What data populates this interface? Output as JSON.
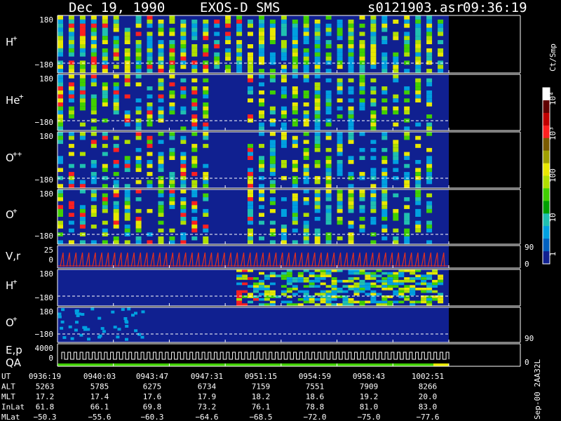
{
  "header": {
    "title": "Dec 19, 1990",
    "instrument": "EXOS-D SMS",
    "file": "s0121903.asr",
    "time": "09:36:19"
  },
  "colorbar": {
    "unit": "Ct/Smp",
    "ticks": [
      "10⁴",
      "10³",
      "100",
      "10",
      "1"
    ],
    "colors": [
      "#ffffff",
      "#600000",
      "#c00000",
      "#ff2020",
      "#7a5a00",
      "#a0a000",
      "#e8e800",
      "#b0e000",
      "#40d000",
      "#00a000",
      "#20c0b0",
      "#00a0e0",
      "#0060c0",
      "#102090"
    ]
  },
  "panels": [
    {
      "id": "h-plus",
      "species": "H",
      "charge": "+",
      "ytop": "180",
      "ybot": "−180"
    },
    {
      "id": "he-plus",
      "species": "He",
      "charge": "+",
      "ytop": "180",
      "ybot": "−180"
    },
    {
      "id": "o-plusplus",
      "species": "O",
      "charge": "++",
      "ytop": "180",
      "ybot": "−180"
    },
    {
      "id": "o-plus",
      "species": "O",
      "charge": "+",
      "ytop": "180",
      "ybot": "−180"
    },
    {
      "id": "vr",
      "label": "V,r",
      "ytop": "25",
      "ybot": "0",
      "right_top": "90",
      "right_bot": "0"
    },
    {
      "id": "h-plus-2",
      "species": "H",
      "charge": "+",
      "ytop": "180",
      "ybot": "−180"
    },
    {
      "id": "o-plus-2",
      "species": "O",
      "charge": "+",
      "ytop": "180",
      "ybot": "−180",
      "right_bot": "90"
    },
    {
      "id": "ep-qa",
      "label1": "E,p",
      "label2": "QA",
      "ytop": "4000",
      "ybot": "0",
      "right_bot": "0"
    }
  ],
  "footer": {
    "rows": [
      {
        "label": "UT",
        "values": [
          "0936:19",
          "0940:03",
          "0943:47",
          "0947:31",
          "0951:15",
          "0954:59",
          "0958:43",
          "1002:51"
        ]
      },
      {
        "label": "ALT",
        "values": [
          "5263",
          "5785",
          "6275",
          "6734",
          "7159",
          "7551",
          "7909",
          "8266"
        ]
      },
      {
        "label": "MLT",
        "values": [
          "17.2",
          "17.4",
          "17.6",
          "17.9",
          "18.2",
          "18.6",
          "19.2",
          "20.0"
        ]
      },
      {
        "label": "InLat",
        "values": [
          "61.8",
          "66.1",
          "69.8",
          "73.2",
          "76.1",
          "78.8",
          "81.0",
          "83.0"
        ]
      },
      {
        "label": "MLat",
        "values": [
          "−50.3",
          "−55.6",
          "−60.3",
          "−64.6",
          "−68.5",
          "−72.0",
          "−75.0",
          "−77.6"
        ]
      }
    ],
    "stamp": "Sep-00  2AA32L"
  },
  "chart_data": {
    "type": "heatmap",
    "title": "Dec 19, 1990   EXOS-D SMS",
    "x": [
      "0936:19",
      "0940:03",
      "0943:47",
      "0947:31",
      "0951:15",
      "0954:59",
      "0958:43",
      "1002:51"
    ],
    "series": [
      {
        "name": "H+",
        "ylim": [
          -180,
          180
        ]
      },
      {
        "name": "He+",
        "ylim": [
          -180,
          180
        ]
      },
      {
        "name": "O++",
        "ylim": [
          -180,
          180
        ]
      },
      {
        "name": "O+",
        "ylim": [
          -180,
          180
        ]
      },
      {
        "name": "V,r",
        "ylim": [
          0,
          25
        ]
      },
      {
        "name": "H+",
        "ylim": [
          -180,
          180
        ]
      },
      {
        "name": "O+",
        "ylim": [
          -180,
          180
        ]
      },
      {
        "name": "E,p QA",
        "ylim": [
          0,
          4000
        ]
      }
    ],
    "colorscale": "log",
    "zlim": [
      1,
      10000
    ],
    "zlabel": "Ct/Smp"
  }
}
